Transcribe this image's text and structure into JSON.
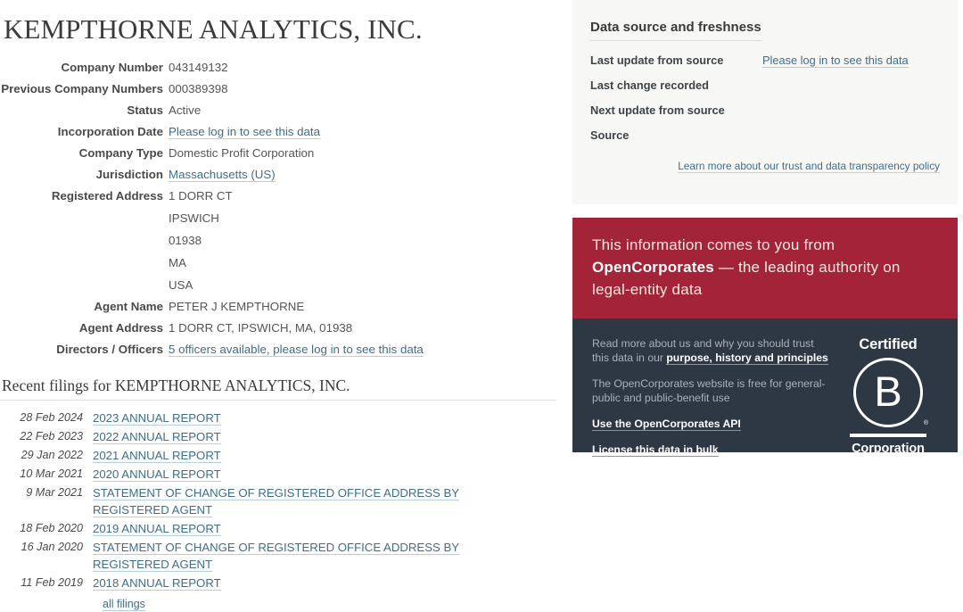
{
  "company": {
    "title": "KEMPTHORNE ANALYTICS, INC.",
    "attributes": [
      {
        "label": "Company Number",
        "value": "043149132",
        "link": false
      },
      {
        "label": "Previous Company Numbers",
        "value": "000389398",
        "link": false
      },
      {
        "label": "Status",
        "value": "Active",
        "link": false
      },
      {
        "label": "Incorporation Date",
        "value": "Please log in to see this data",
        "link": true
      },
      {
        "label": "Company Type",
        "value": "Domestic Profit Corporation",
        "link": false
      },
      {
        "label": "Jurisdiction",
        "value": "Massachusetts (US)",
        "link": true
      },
      {
        "label": "Registered Address",
        "value": "1 DORR CT\nIPSWICH\n01938\nMA\nUSA",
        "link": false,
        "multiline": true
      },
      {
        "label": "Agent Name",
        "value": "PETER J KEMPTHORNE",
        "link": false
      },
      {
        "label": "Agent Address",
        "value": "1 DORR CT, IPSWICH, MA, 01938",
        "link": false
      },
      {
        "label": "Directors / Officers",
        "value": "5 officers available, please log in to see this data",
        "link": true
      }
    ]
  },
  "filings": {
    "heading": "Recent filings for KEMPTHORNE ANALYTICS, INC.",
    "all_filings_label": "all filings",
    "rows": [
      {
        "date": "28 Feb 2024",
        "title": "2023 ANNUAL REPORT"
      },
      {
        "date": "22 Feb 2023",
        "title": "2022 ANNUAL REPORT"
      },
      {
        "date": "29 Jan 2022",
        "title": "2021 ANNUAL REPORT"
      },
      {
        "date": "10 Mar 2021",
        "title": "2020 ANNUAL REPORT"
      },
      {
        "date": "9 Mar 2021",
        "title": "STATEMENT OF CHANGE OF REGISTERED OFFICE ADDRESS BY REGISTERED AGENT"
      },
      {
        "date": "18 Feb 2020",
        "title": "2019 ANNUAL REPORT"
      },
      {
        "date": "16 Jan 2020",
        "title": "STATEMENT OF CHANGE OF REGISTERED OFFICE ADDRESS BY REGISTERED AGENT"
      },
      {
        "date": "11 Feb 2019",
        "title": "2018 ANNUAL REPORT"
      }
    ]
  },
  "data_source": {
    "title": "Data source and freshness",
    "rows": [
      {
        "label": "Last update from source",
        "value": "Please log in to see this data",
        "link": true
      },
      {
        "label": "Last change recorded",
        "value": "",
        "link": false
      },
      {
        "label": "Next update from source",
        "value": "",
        "link": false
      },
      {
        "label": "Source",
        "value": "",
        "link": false
      }
    ],
    "footer_link": "Learn more about our trust and data transparency policy"
  },
  "promo": {
    "banner_lead": "This information comes to you from ",
    "banner_brand": "OpenCorporates",
    "banner_tail": " — the leading authority on legal-entity data",
    "trust_text_lead": "Read more about us and why you should trust this data in our ",
    "trust_link": "purpose, history and principles",
    "free_text": "The OpenCorporates website is free for general-public and public-benefit use",
    "api_link": "Use the OpenCorporates API",
    "license_link": "License this data in bulk",
    "bcorp_certified": "Certified",
    "bcorp_letter": "B",
    "bcorp_registered": "®",
    "bcorp_corporation": "Corporation"
  },
  "colors": {
    "banner_red": "#a32339",
    "panel_dark": "#2e3845",
    "panel_gray": "#f7f7f6",
    "link_blue": "#3f6e8c"
  }
}
